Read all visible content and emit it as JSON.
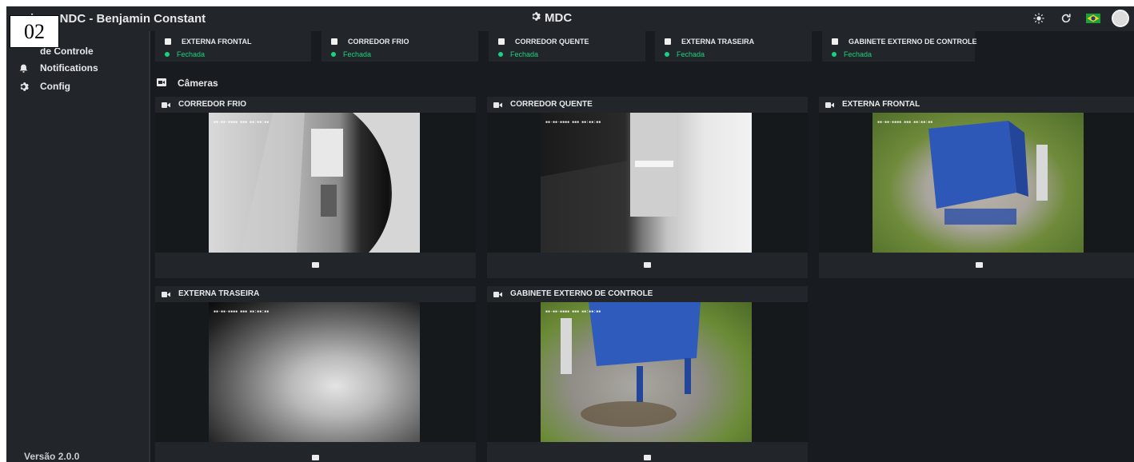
{
  "page_tag": "02",
  "app": {
    "title": "iner: NDC - Benjamin Constant",
    "center_title": "MDC",
    "version": "Versão 2.0.0"
  },
  "icons": {
    "brightness": "sun-icon",
    "refresh": "refresh-icon",
    "language": "brazil-flag-icon",
    "user": "avatar",
    "settings": "gear-icon"
  },
  "sidebar": {
    "items": [
      {
        "label": "de Controle",
        "icon": "control-icon"
      },
      {
        "label": "Notifications",
        "icon": "bell-icon"
      },
      {
        "label": "Config",
        "icon": "gear-icon"
      }
    ]
  },
  "doors": [
    {
      "label": "EXTERNA FRONTAL",
      "status": "Fechada"
    },
    {
      "label": "CORREDOR FRIO",
      "status": "Fechada"
    },
    {
      "label": "CORREDOR QUENTE",
      "status": "Fechada"
    },
    {
      "label": "EXTERNA TRASEIRA",
      "status": "Fechada"
    },
    {
      "label": "GABINETE EXTERNO DE CONTROLE",
      "status": "Fechada"
    }
  ],
  "cameras_heading": "Câmeras",
  "cameras": [
    {
      "label": "CORREDOR FRIO"
    },
    {
      "label": "CORREDOR QUENTE"
    },
    {
      "label": "EXTERNA FRONTAL"
    },
    {
      "label": "EXTERNA TRASEIRA"
    },
    {
      "label": "GABINETE EXTERNO DE CONTROLE"
    }
  ],
  "colors": {
    "background": "#181b1f",
    "panel": "#22262b",
    "status_ok": "#19d27c"
  }
}
